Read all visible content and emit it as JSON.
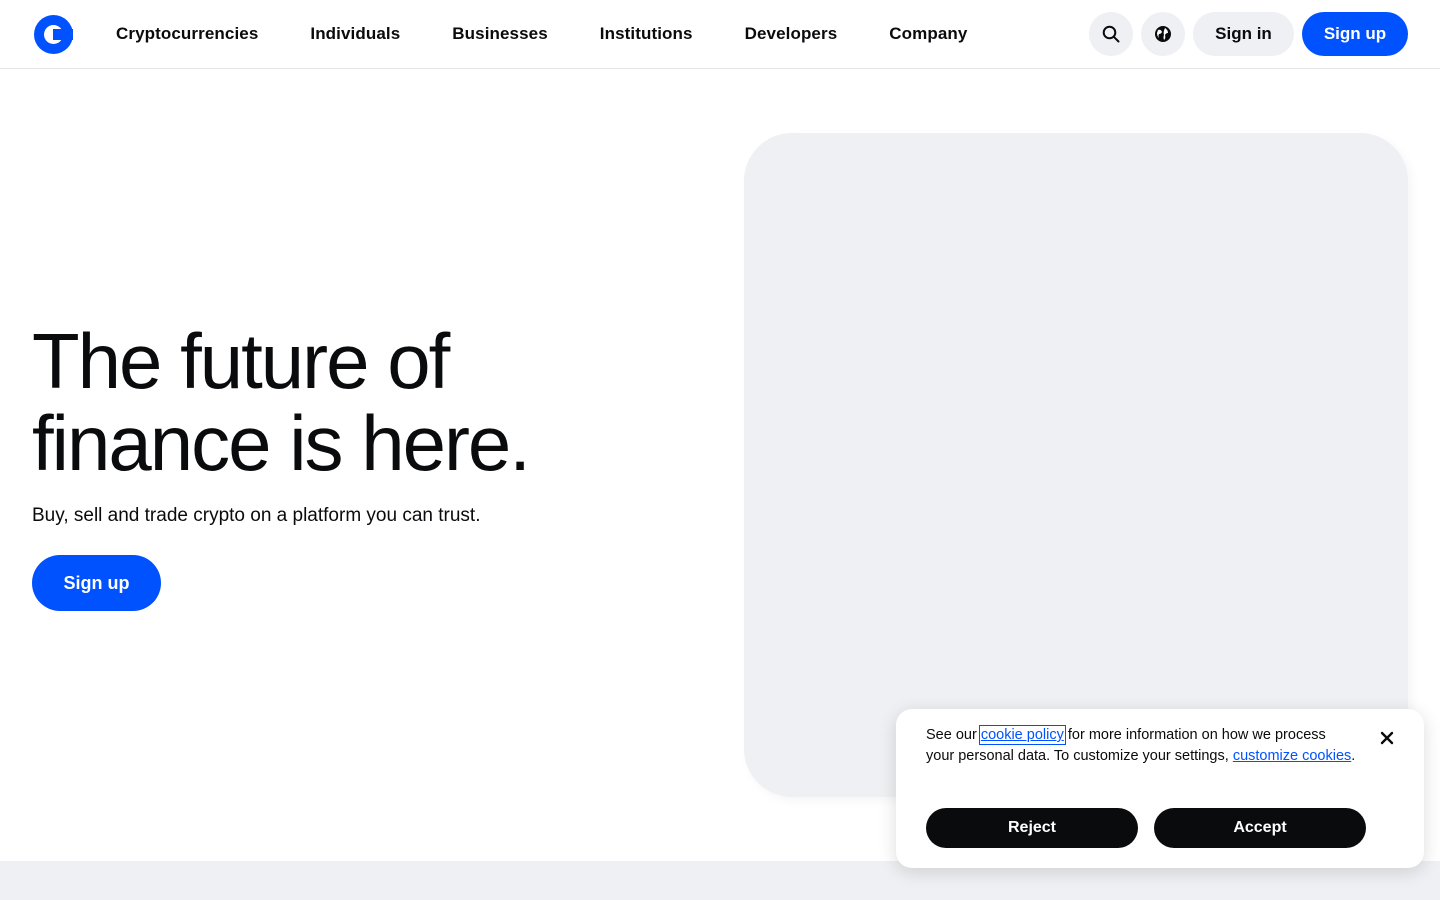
{
  "header": {
    "logo_icon": "coinbase-logo-icon",
    "nav": [
      {
        "label": "Cryptocurrencies"
      },
      {
        "label": "Individuals"
      },
      {
        "label": "Businesses"
      },
      {
        "label": "Institutions"
      },
      {
        "label": "Developers"
      },
      {
        "label": "Company"
      }
    ],
    "search_icon": "search-icon",
    "language_icon": "globe-icon",
    "sign_in": "Sign in",
    "sign_up": "Sign up"
  },
  "hero": {
    "title_line1": "The future of",
    "title_line2": "finance is here.",
    "subtitle": "Buy, sell and trade crypto on a platform you can trust.",
    "cta": "Sign up"
  },
  "cookie": {
    "text_before": "See our ",
    "policy_link": "cookie policy",
    "text_middle": " for more information on how we process your personal data. To customize your settings, ",
    "customize_link": "customize cookies",
    "text_after": ".",
    "reject": "Reject",
    "accept": "Accept",
    "close_icon": "close-icon"
  },
  "colors": {
    "brand_blue": "#0052ff",
    "text": "#0a0b0d",
    "surface": "#eef0f3"
  }
}
